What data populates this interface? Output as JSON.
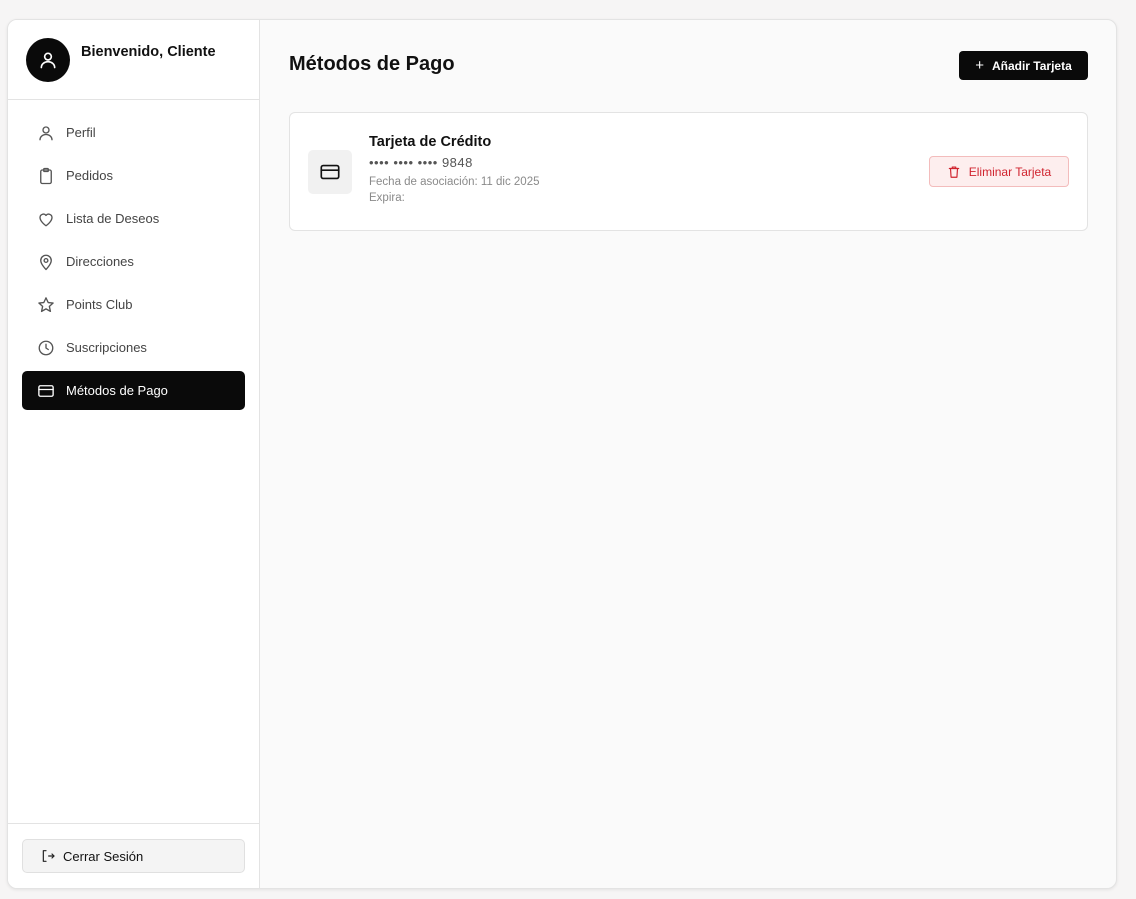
{
  "sidebar": {
    "welcome": "Bienvenido, Cliente",
    "items": [
      {
        "label": "Perfil",
        "icon": "user-icon"
      },
      {
        "label": "Pedidos",
        "icon": "clipboard-icon"
      },
      {
        "label": "Lista de Deseos",
        "icon": "heart-icon"
      },
      {
        "label": "Direcciones",
        "icon": "map-pin-icon"
      },
      {
        "label": "Points Club",
        "icon": "star-icon"
      },
      {
        "label": "Suscripciones",
        "icon": "clock-icon"
      },
      {
        "label": "Métodos de Pago",
        "icon": "credit-card-icon",
        "active": true
      }
    ],
    "logout_label": "Cerrar Sesión"
  },
  "main": {
    "title": "Métodos de Pago",
    "add_button_label": "Añadir Tarjeta",
    "cards": [
      {
        "title": "Tarjeta de Crédito",
        "number": "•••• •••• •••• 9848",
        "associated": "Fecha de asociación: 11 dic 2025",
        "expires": "Expira:",
        "delete_label": "Eliminar Tarjeta"
      }
    ]
  },
  "colors": {
    "accent": "#0a0a0a",
    "danger": "#d0242f",
    "danger_bg": "#fdeeee"
  }
}
